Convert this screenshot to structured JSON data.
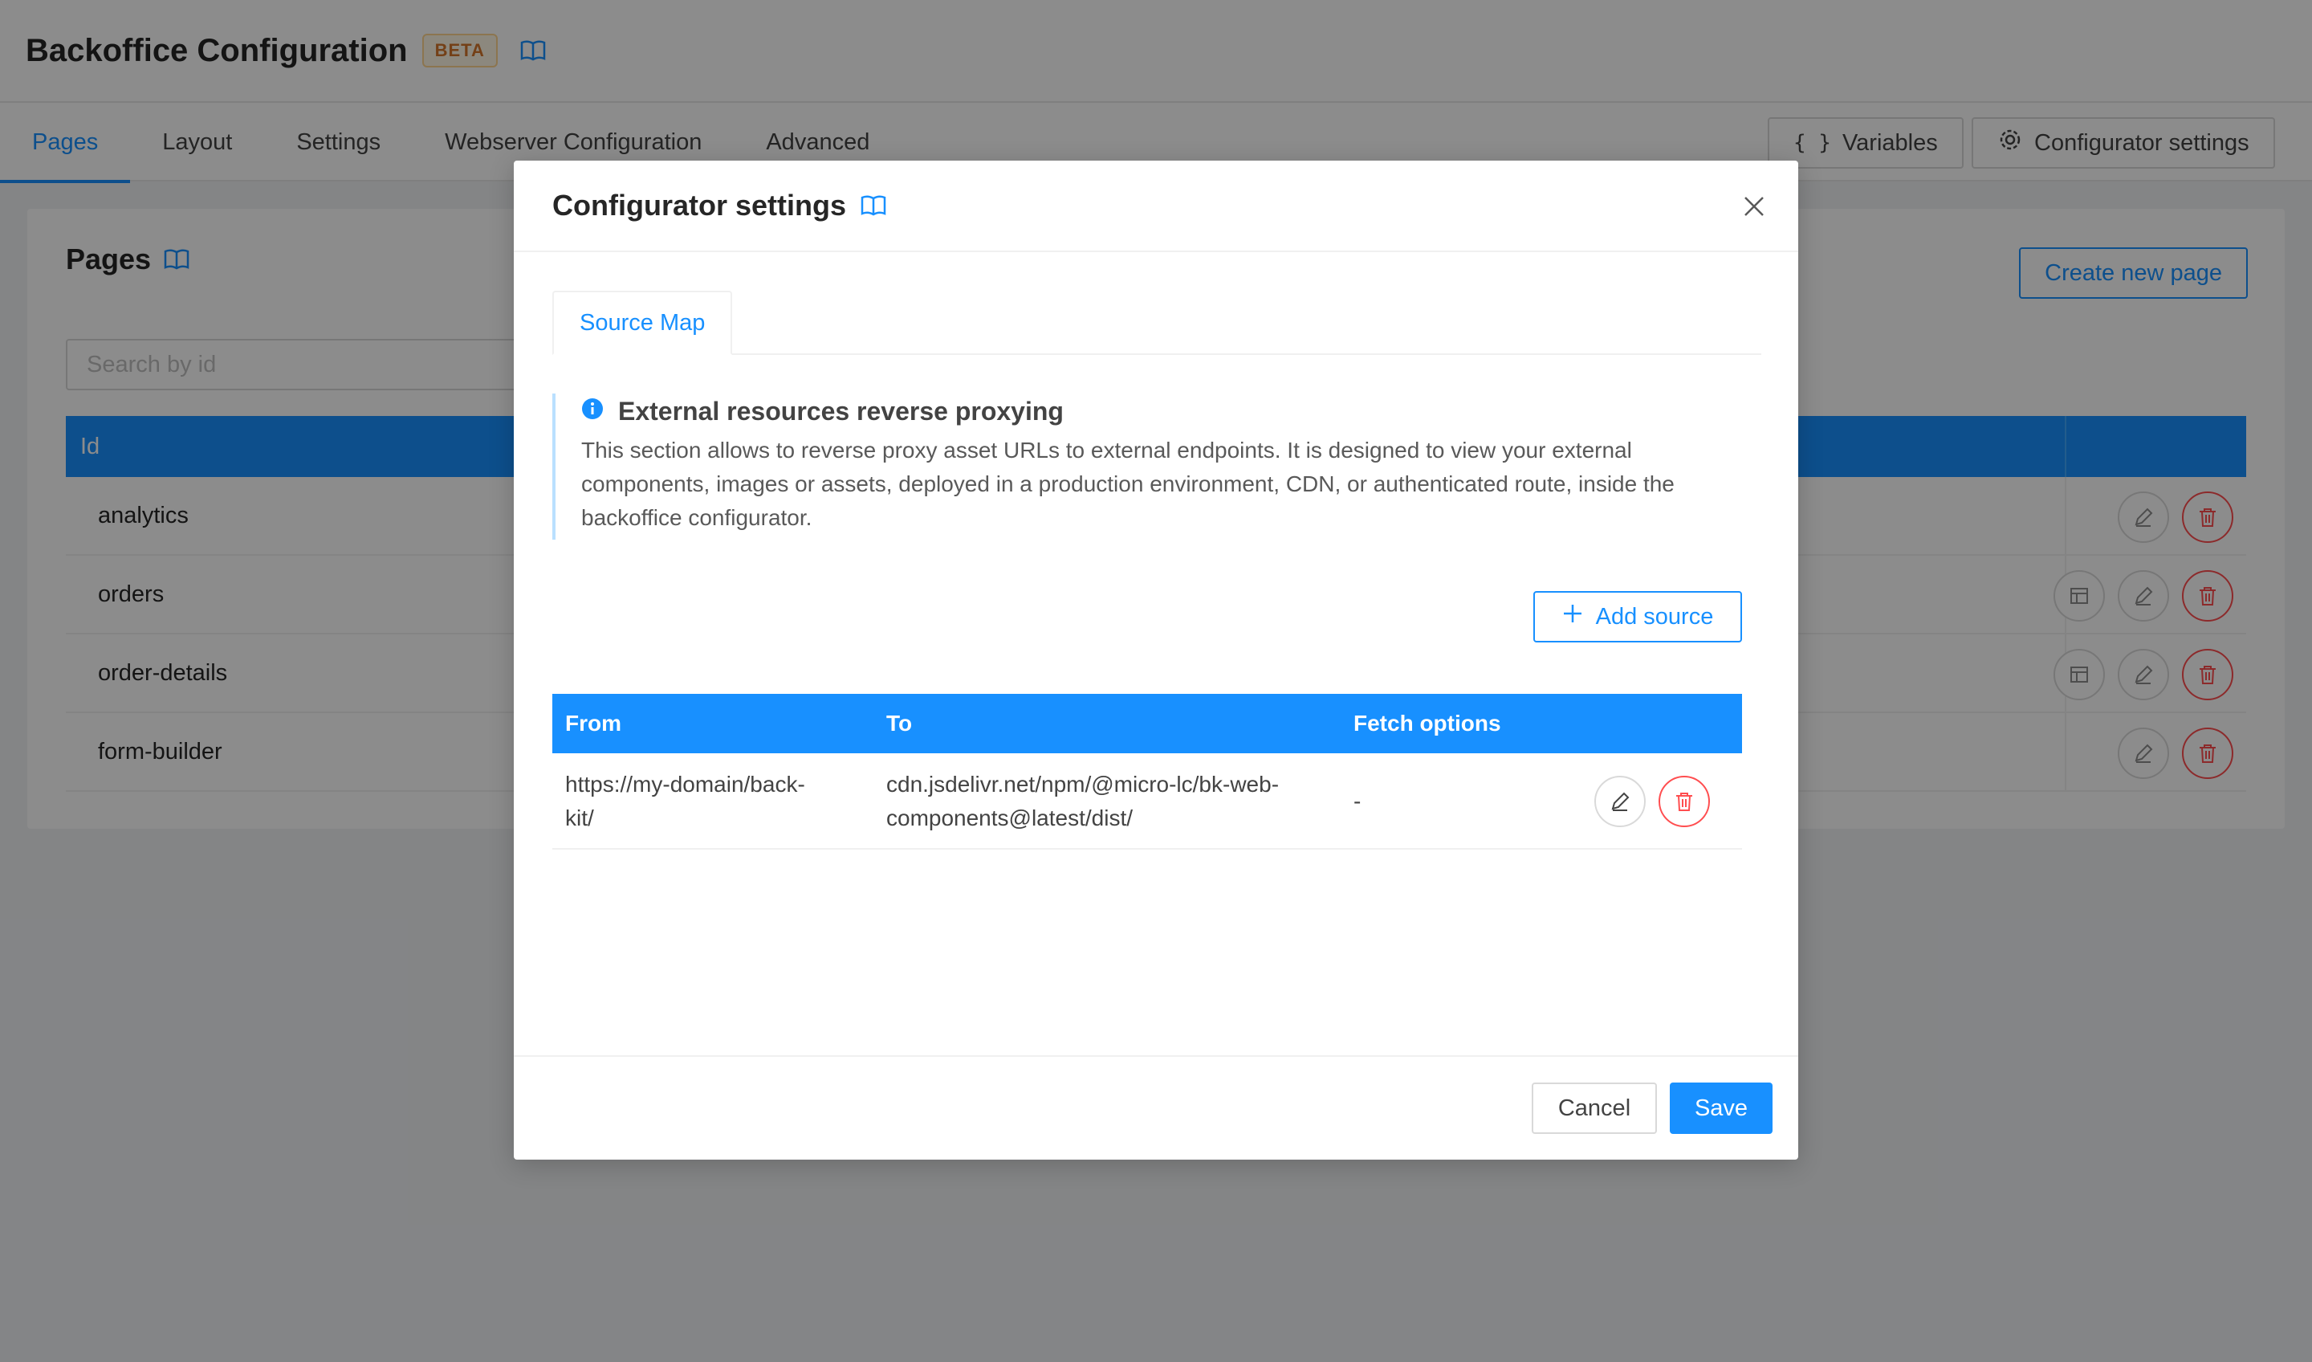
{
  "app": {
    "title": "Backoffice Configuration",
    "badge": "BETA",
    "tabs": [
      "Pages",
      "Layout",
      "Settings",
      "Webserver Configuration",
      "Advanced"
    ],
    "active_tab": "Pages",
    "variables_label": "Variables",
    "configurator_settings_label": "Configurator settings"
  },
  "pages_card": {
    "title": "Pages",
    "create_label": "Create new page",
    "search_placeholder": "Search by id",
    "table": {
      "header_id": "Id",
      "rows": [
        "analytics",
        "orders",
        "order-details",
        "form-builder"
      ]
    }
  },
  "modal": {
    "title": "Configurator settings",
    "tab": "Source Map",
    "alert": {
      "title": "External resources reverse proxying",
      "text": "This section allows to reverse proxy asset URLs to external endpoints. It is designed to view your external components, images or assets, deployed in a production environment, CDN, or authenticated route, inside the backoffice configurator."
    },
    "add_source_label": "Add source",
    "table": {
      "headers": [
        "From",
        "To",
        "Fetch options"
      ],
      "rows": [
        {
          "from_line1": "https://my-domain/back-",
          "from_line2": "kit/",
          "to_line1": "cdn.jsdelivr.net/npm/@micro-lc/bk-web-",
          "to_line2": "components@latest/dist/",
          "fetch_options": "-"
        }
      ]
    },
    "cancel_label": "Cancel",
    "save_label": "Save"
  },
  "colors": {
    "primary": "#1890ff",
    "danger": "#ff4d4f",
    "beta": "#d4762a"
  }
}
